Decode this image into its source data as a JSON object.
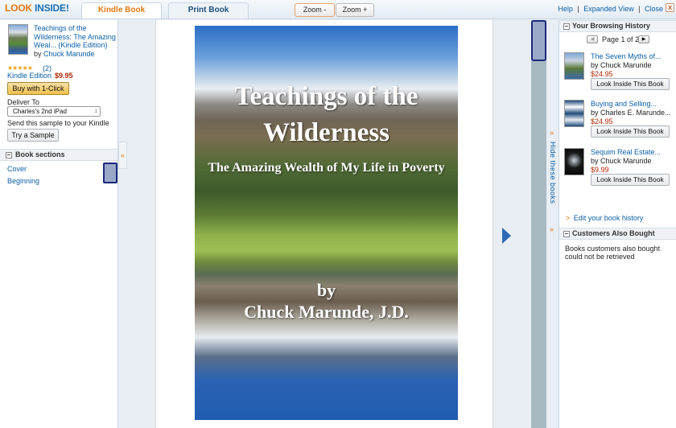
{
  "header": {
    "logo_part1": "LOOK",
    "logo_part2": "INSIDE!",
    "tabs": [
      {
        "label": "Kindle Book",
        "active": true
      },
      {
        "label": "Print Book",
        "active": false
      }
    ],
    "zoom_out": "Zoom -",
    "zoom_in": "Zoom +",
    "links": {
      "help": "Help",
      "expanded": "Expanded View",
      "close": "Close",
      "sep": "|"
    },
    "close_icon": "x"
  },
  "book": {
    "title": "Teachings of the Wilderness: The Amazing Weal... (Kindle Edition)",
    "by_prefix": "by",
    "author": "Chuck Marunde",
    "stars": "★★★★★",
    "rating_value": 5,
    "review_count": "(2)",
    "format": "Kindle Edition",
    "price": "$9.95",
    "buy_button": "Buy with 1-Click",
    "deliver_label": "Deliver To",
    "deliver_device": "Charles's 2nd iPad",
    "send_sample_text": "Send this sample to your Kindle",
    "try_sample_button": "Try a Sample"
  },
  "sections": {
    "header": "Book sections",
    "items": [
      "Cover",
      "Beginning"
    ],
    "collapse_icon": "«"
  },
  "cover": {
    "title": "Teachings of the Wilderness",
    "subtitle": "The Amazing Wealth of My Life in Poverty",
    "by": "by",
    "author": "Chuck Marunde, J.D."
  },
  "hide_strip": {
    "label": "Hide these books",
    "chevron": "»"
  },
  "history": {
    "header": "Your Browsing History",
    "page_label": "Page 1 of 2",
    "books": [
      {
        "title": "The Seven Myths of...",
        "author": "by Chuck Marunde",
        "price": "$24.95",
        "button": "Look Inside This Book"
      },
      {
        "title": "Buying and Selling...",
        "author": "by Charles E. Marunde...",
        "price": "$24.95",
        "button": "Look Inside This Book"
      },
      {
        "title": "Sequim Real Estate...",
        "author": "by Chuck Marunde",
        "price": "$9.99",
        "button": "Look Inside This Book"
      }
    ],
    "edit_link": "Edit your book history",
    "edit_prefix": ">"
  },
  "also_bought": {
    "header": "Customers Also Bought",
    "message": "Books customers also bought could not be retrieved"
  },
  "colors": {
    "accent_orange": "#e47911",
    "link_blue": "#0b5fa8",
    "price_red": "#b12704"
  }
}
